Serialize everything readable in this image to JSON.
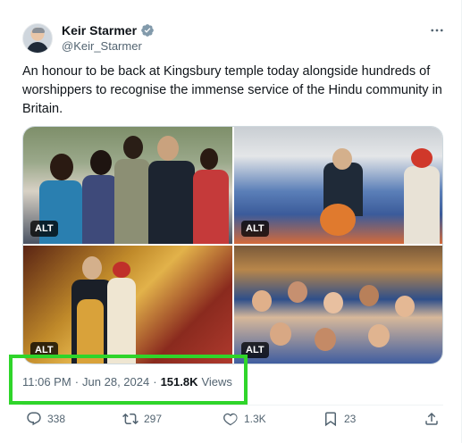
{
  "author": {
    "display_name": "Keir Starmer",
    "handle": "@Keir_Starmer",
    "verified": true,
    "verified_color": "#829aab"
  },
  "tweet": {
    "text": "An honour to be back at Kingsbury temple today alongside hundreds of worshippers to recognise the immense service of the Hindu community in Britain."
  },
  "media": [
    {
      "alt_label": "ALT"
    },
    {
      "alt_label": "ALT"
    },
    {
      "alt_label": "ALT"
    },
    {
      "alt_label": "ALT"
    }
  ],
  "meta": {
    "time": "11:06 PM",
    "separator": "·",
    "date": "Jun 28, 2024",
    "separator2": "·",
    "views_count": "151.8K",
    "views_label": "Views"
  },
  "actions": {
    "replies": "338",
    "retweets": "297",
    "likes": "1.3K",
    "bookmarks": "23"
  },
  "colors": {
    "text_primary": "#0f1419",
    "text_secondary": "#536471",
    "highlight": "#2fd52a"
  }
}
